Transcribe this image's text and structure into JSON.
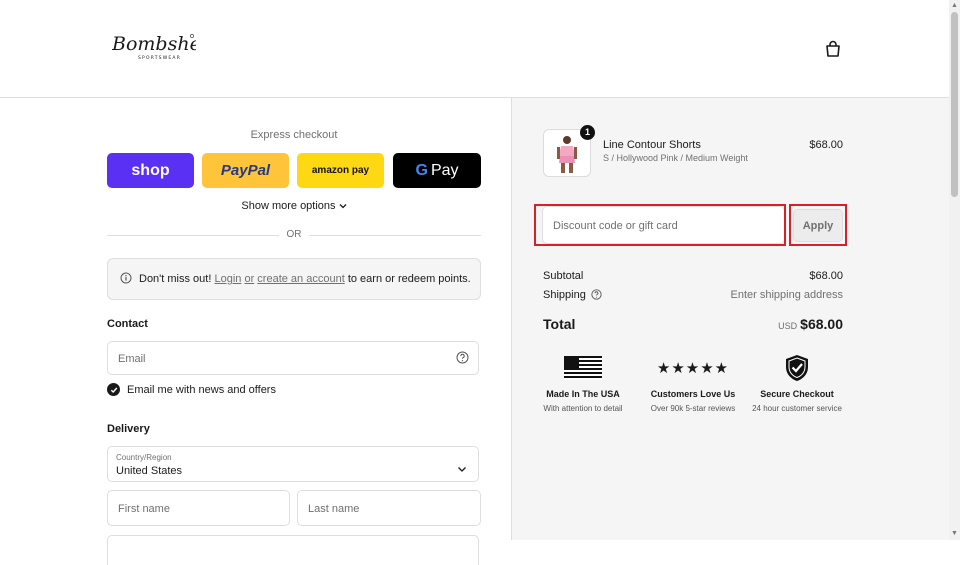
{
  "brand": {
    "logo_text": "Bombshell",
    "logo_subtext": "SPORTSWEAR"
  },
  "express": {
    "title": "Express checkout",
    "buttons": {
      "shop": "shop",
      "paypal": "PayPal",
      "amazon": "amazon pay",
      "gpay": "Pay"
    },
    "show_more": "Show more options",
    "or": "OR"
  },
  "notice": {
    "prefix": "Don't miss out!",
    "login": "Login",
    "or": "or",
    "create": "create an account",
    "suffix": "to earn or redeem points."
  },
  "contact": {
    "title": "Contact",
    "email_placeholder": "Email",
    "newsletter_label": "Email me with news and offers"
  },
  "delivery": {
    "title": "Delivery",
    "country_label": "Country/Region",
    "country_value": "United States",
    "first_name_placeholder": "First name",
    "last_name_placeholder": "Last name"
  },
  "order": {
    "item": {
      "quantity": "1",
      "name": "Line Contour Shorts",
      "variant": "S / Hollywood Pink / Medium Weight",
      "price": "$68.00"
    },
    "discount_placeholder": "Discount code or gift card",
    "apply_label": "Apply",
    "subtotal_label": "Subtotal",
    "subtotal_value": "$68.00",
    "shipping_label": "Shipping",
    "shipping_value": "Enter shipping address",
    "total_label": "Total",
    "currency": "USD",
    "total_value": "$68.00"
  },
  "badges": [
    {
      "title": "Made In The USA",
      "sub": "With attention to detail",
      "icon": "us-flag-icon"
    },
    {
      "title": "Customers Love Us",
      "sub": "Over 90k 5-star reviews",
      "icon": "five-stars-icon",
      "stars": "★★★★★"
    },
    {
      "title": "Secure Checkout",
      "sub": "24 hour customer service",
      "icon": "shield-check-icon"
    }
  ],
  "colors": {
    "shop": "#5a31f4",
    "paypal": "#ffc439",
    "amazon": "#ffd814",
    "gpay": "#000000",
    "highlight": "#d9202a"
  }
}
